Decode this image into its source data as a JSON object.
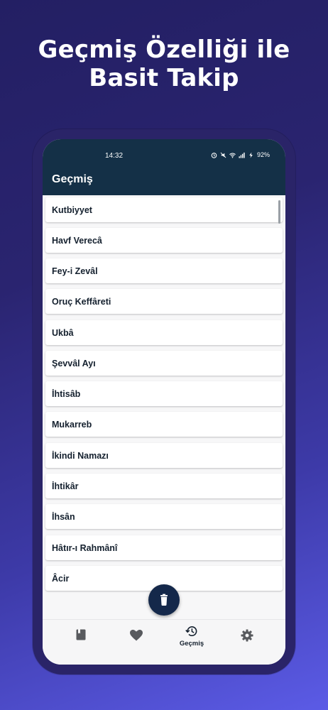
{
  "headline": {
    "line1": "Geçmiş Özelliği ile",
    "line2": "Basit Takip"
  },
  "status_bar": {
    "time": "14:32",
    "battery": "92%"
  },
  "app_bar": {
    "title": "Geçmiş"
  },
  "history_items": [
    "Kutbiyyet",
    "Havf Verecâ",
    "Fey-i Zevâl",
    "Oruç Keffâreti",
    "Ukbâ",
    "Şevvâl Ayı",
    "İhtisâb",
    "Mukarreb",
    "İkindi Namazı",
    "İhtikâr",
    "İhsân",
    "Hâtır-ı Rahmânî",
    "Âcir"
  ],
  "bottom_nav": {
    "items": [
      {
        "icon": "book-icon",
        "label": ""
      },
      {
        "icon": "heart-icon",
        "label": ""
      },
      {
        "icon": "history-icon",
        "label": "Geçmiş"
      },
      {
        "icon": "gear-icon",
        "label": ""
      }
    ],
    "selected": 2
  },
  "colors": {
    "app_bar": "#143047",
    "fab": "#14284a",
    "text": "#14202e",
    "background_gradient_start": "#231f63",
    "background_gradient_end": "#5b5be6"
  }
}
